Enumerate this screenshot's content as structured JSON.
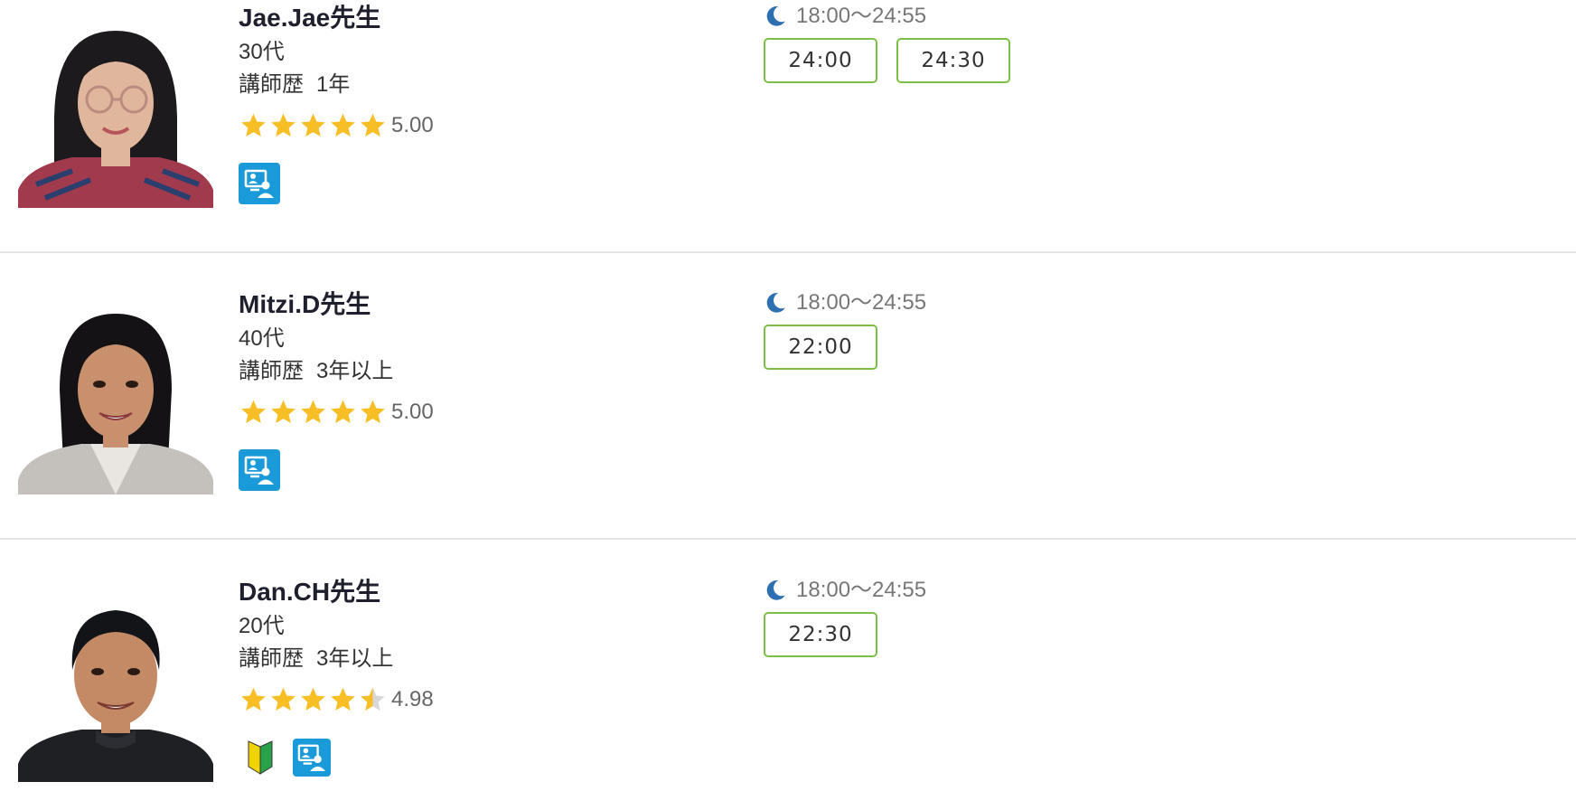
{
  "teachers": [
    {
      "name": "Jae.Jae先生",
      "age": "30代",
      "experience_label": "講師歴",
      "experience_value": "1年",
      "rating": 5.0,
      "rating_text": "5.00",
      "badges": [
        "online-lesson-icon"
      ],
      "hours": "18:00〜24:55",
      "times": [
        "24:00",
        "24:30"
      ]
    },
    {
      "name": "Mitzi.D先生",
      "age": "40代",
      "experience_label": "講師歴",
      "experience_value": "3年以上",
      "rating": 5.0,
      "rating_text": "5.00",
      "badges": [
        "online-lesson-icon"
      ],
      "hours": "18:00〜24:55",
      "times": [
        "22:00"
      ]
    },
    {
      "name": "Dan.CH先生",
      "age": "20代",
      "experience_label": "講師歴",
      "experience_value": "3年以上",
      "rating": 4.98,
      "rating_text": "4.98",
      "badges": [
        "beginner-mark-icon",
        "online-lesson-icon"
      ],
      "hours": "18:00〜24:55",
      "times": [
        "22:30"
      ]
    }
  ],
  "colors": {
    "star": "#f7be26",
    "star_empty": "#d8d8d8",
    "slot_border": "#7cc043",
    "online_badge": "#1a9ad9",
    "moon": "#2d6fb0",
    "divider": "#e4e4e4"
  }
}
